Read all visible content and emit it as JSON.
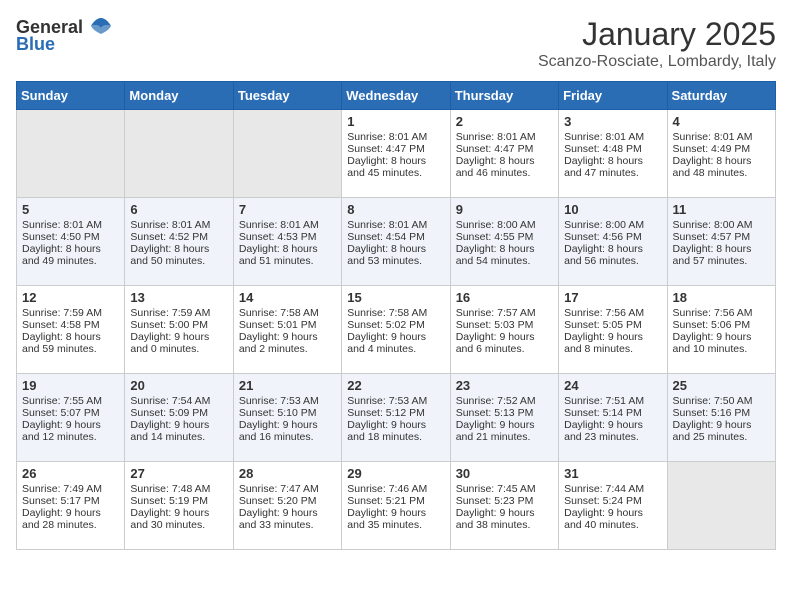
{
  "logo": {
    "general": "General",
    "blue": "Blue"
  },
  "title": {
    "month": "January 2025",
    "location": "Scanzo-Rosciate, Lombardy, Italy"
  },
  "days_of_week": [
    "Sunday",
    "Monday",
    "Tuesday",
    "Wednesday",
    "Thursday",
    "Friday",
    "Saturday"
  ],
  "weeks": [
    [
      {
        "day": "",
        "sunrise": "",
        "sunset": "",
        "daylight": ""
      },
      {
        "day": "",
        "sunrise": "",
        "sunset": "",
        "daylight": ""
      },
      {
        "day": "",
        "sunrise": "",
        "sunset": "",
        "daylight": ""
      },
      {
        "day": "1",
        "sunrise": "Sunrise: 8:01 AM",
        "sunset": "Sunset: 4:47 PM",
        "daylight": "Daylight: 8 hours and 45 minutes."
      },
      {
        "day": "2",
        "sunrise": "Sunrise: 8:01 AM",
        "sunset": "Sunset: 4:47 PM",
        "daylight": "Daylight: 8 hours and 46 minutes."
      },
      {
        "day": "3",
        "sunrise": "Sunrise: 8:01 AM",
        "sunset": "Sunset: 4:48 PM",
        "daylight": "Daylight: 8 hours and 47 minutes."
      },
      {
        "day": "4",
        "sunrise": "Sunrise: 8:01 AM",
        "sunset": "Sunset: 4:49 PM",
        "daylight": "Daylight: 8 hours and 48 minutes."
      }
    ],
    [
      {
        "day": "5",
        "sunrise": "Sunrise: 8:01 AM",
        "sunset": "Sunset: 4:50 PM",
        "daylight": "Daylight: 8 hours and 49 minutes."
      },
      {
        "day": "6",
        "sunrise": "Sunrise: 8:01 AM",
        "sunset": "Sunset: 4:52 PM",
        "daylight": "Daylight: 8 hours and 50 minutes."
      },
      {
        "day": "7",
        "sunrise": "Sunrise: 8:01 AM",
        "sunset": "Sunset: 4:53 PM",
        "daylight": "Daylight: 8 hours and 51 minutes."
      },
      {
        "day": "8",
        "sunrise": "Sunrise: 8:01 AM",
        "sunset": "Sunset: 4:54 PM",
        "daylight": "Daylight: 8 hours and 53 minutes."
      },
      {
        "day": "9",
        "sunrise": "Sunrise: 8:00 AM",
        "sunset": "Sunset: 4:55 PM",
        "daylight": "Daylight: 8 hours and 54 minutes."
      },
      {
        "day": "10",
        "sunrise": "Sunrise: 8:00 AM",
        "sunset": "Sunset: 4:56 PM",
        "daylight": "Daylight: 8 hours and 56 minutes."
      },
      {
        "day": "11",
        "sunrise": "Sunrise: 8:00 AM",
        "sunset": "Sunset: 4:57 PM",
        "daylight": "Daylight: 8 hours and 57 minutes."
      }
    ],
    [
      {
        "day": "12",
        "sunrise": "Sunrise: 7:59 AM",
        "sunset": "Sunset: 4:58 PM",
        "daylight": "Daylight: 8 hours and 59 minutes."
      },
      {
        "day": "13",
        "sunrise": "Sunrise: 7:59 AM",
        "sunset": "Sunset: 5:00 PM",
        "daylight": "Daylight: 9 hours and 0 minutes."
      },
      {
        "day": "14",
        "sunrise": "Sunrise: 7:58 AM",
        "sunset": "Sunset: 5:01 PM",
        "daylight": "Daylight: 9 hours and 2 minutes."
      },
      {
        "day": "15",
        "sunrise": "Sunrise: 7:58 AM",
        "sunset": "Sunset: 5:02 PM",
        "daylight": "Daylight: 9 hours and 4 minutes."
      },
      {
        "day": "16",
        "sunrise": "Sunrise: 7:57 AM",
        "sunset": "Sunset: 5:03 PM",
        "daylight": "Daylight: 9 hours and 6 minutes."
      },
      {
        "day": "17",
        "sunrise": "Sunrise: 7:56 AM",
        "sunset": "Sunset: 5:05 PM",
        "daylight": "Daylight: 9 hours and 8 minutes."
      },
      {
        "day": "18",
        "sunrise": "Sunrise: 7:56 AM",
        "sunset": "Sunset: 5:06 PM",
        "daylight": "Daylight: 9 hours and 10 minutes."
      }
    ],
    [
      {
        "day": "19",
        "sunrise": "Sunrise: 7:55 AM",
        "sunset": "Sunset: 5:07 PM",
        "daylight": "Daylight: 9 hours and 12 minutes."
      },
      {
        "day": "20",
        "sunrise": "Sunrise: 7:54 AM",
        "sunset": "Sunset: 5:09 PM",
        "daylight": "Daylight: 9 hours and 14 minutes."
      },
      {
        "day": "21",
        "sunrise": "Sunrise: 7:53 AM",
        "sunset": "Sunset: 5:10 PM",
        "daylight": "Daylight: 9 hours and 16 minutes."
      },
      {
        "day": "22",
        "sunrise": "Sunrise: 7:53 AM",
        "sunset": "Sunset: 5:12 PM",
        "daylight": "Daylight: 9 hours and 18 minutes."
      },
      {
        "day": "23",
        "sunrise": "Sunrise: 7:52 AM",
        "sunset": "Sunset: 5:13 PM",
        "daylight": "Daylight: 9 hours and 21 minutes."
      },
      {
        "day": "24",
        "sunrise": "Sunrise: 7:51 AM",
        "sunset": "Sunset: 5:14 PM",
        "daylight": "Daylight: 9 hours and 23 minutes."
      },
      {
        "day": "25",
        "sunrise": "Sunrise: 7:50 AM",
        "sunset": "Sunset: 5:16 PM",
        "daylight": "Daylight: 9 hours and 25 minutes."
      }
    ],
    [
      {
        "day": "26",
        "sunrise": "Sunrise: 7:49 AM",
        "sunset": "Sunset: 5:17 PM",
        "daylight": "Daylight: 9 hours and 28 minutes."
      },
      {
        "day": "27",
        "sunrise": "Sunrise: 7:48 AM",
        "sunset": "Sunset: 5:19 PM",
        "daylight": "Daylight: 9 hours and 30 minutes."
      },
      {
        "day": "28",
        "sunrise": "Sunrise: 7:47 AM",
        "sunset": "Sunset: 5:20 PM",
        "daylight": "Daylight: 9 hours and 33 minutes."
      },
      {
        "day": "29",
        "sunrise": "Sunrise: 7:46 AM",
        "sunset": "Sunset: 5:21 PM",
        "daylight": "Daylight: 9 hours and 35 minutes."
      },
      {
        "day": "30",
        "sunrise": "Sunrise: 7:45 AM",
        "sunset": "Sunset: 5:23 PM",
        "daylight": "Daylight: 9 hours and 38 minutes."
      },
      {
        "day": "31",
        "sunrise": "Sunrise: 7:44 AM",
        "sunset": "Sunset: 5:24 PM",
        "daylight": "Daylight: 9 hours and 40 minutes."
      },
      {
        "day": "",
        "sunrise": "",
        "sunset": "",
        "daylight": ""
      }
    ]
  ]
}
